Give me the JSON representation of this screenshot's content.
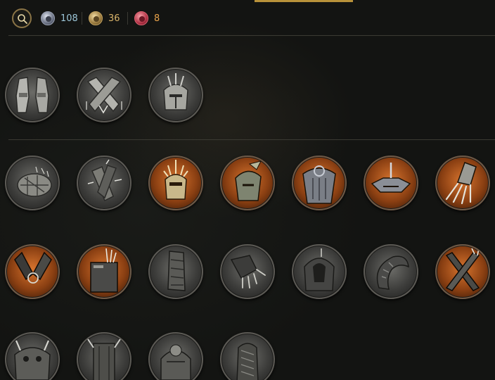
{
  "header": {
    "search_icon": "search-icon",
    "currencies": [
      {
        "name": "silver-coin-icon",
        "value": "108",
        "color": "#9cc6d8"
      },
      {
        "name": "gold-coin-icon",
        "value": "36",
        "color": "#d9b46a"
      },
      {
        "name": "red-gem-icon",
        "value": "8",
        "color": "#e8a24a"
      }
    ]
  },
  "sections": [
    {
      "items": [
        {
          "icon": "leg-armor-icon",
          "rarity": "common"
        },
        {
          "icon": "crossed-gauntlets-icon",
          "rarity": "common"
        },
        {
          "icon": "spiked-helmet-icon",
          "rarity": "common"
        }
      ]
    },
    {
      "items": [
        {
          "icon": "cage-helmet-icon",
          "rarity": "common"
        },
        {
          "icon": "spiked-gauntlets-icon",
          "rarity": "common"
        },
        {
          "icon": "crowned-helm-icon",
          "rarity": "rare"
        },
        {
          "icon": "winged-helm-icon",
          "rarity": "rare"
        },
        {
          "icon": "chest-armor-icon",
          "rarity": "rare"
        },
        {
          "icon": "horned-helm-icon",
          "rarity": "rare"
        },
        {
          "icon": "claw-gauntlet-icon",
          "rarity": "rare"
        },
        {
          "icon": "bound-gauntlets-icon",
          "rarity": "rare"
        },
        {
          "icon": "spiked-greaves-icon",
          "rarity": "rare"
        },
        {
          "icon": "bracer-icon",
          "rarity": "common"
        },
        {
          "icon": "clawed-glove-icon",
          "rarity": "common"
        },
        {
          "icon": "hooded-helm-icon",
          "rarity": "common"
        },
        {
          "icon": "curved-gauntlet-icon",
          "rarity": "common"
        },
        {
          "icon": "crossed-blades-icon",
          "rarity": "rare"
        },
        {
          "icon": "demon-helm-icon",
          "rarity": "common"
        },
        {
          "icon": "horned-armor-icon",
          "rarity": "common"
        },
        {
          "icon": "ornate-helm-icon",
          "rarity": "common"
        },
        {
          "icon": "chain-gauntlet-icon",
          "rarity": "common"
        }
      ]
    }
  ]
}
